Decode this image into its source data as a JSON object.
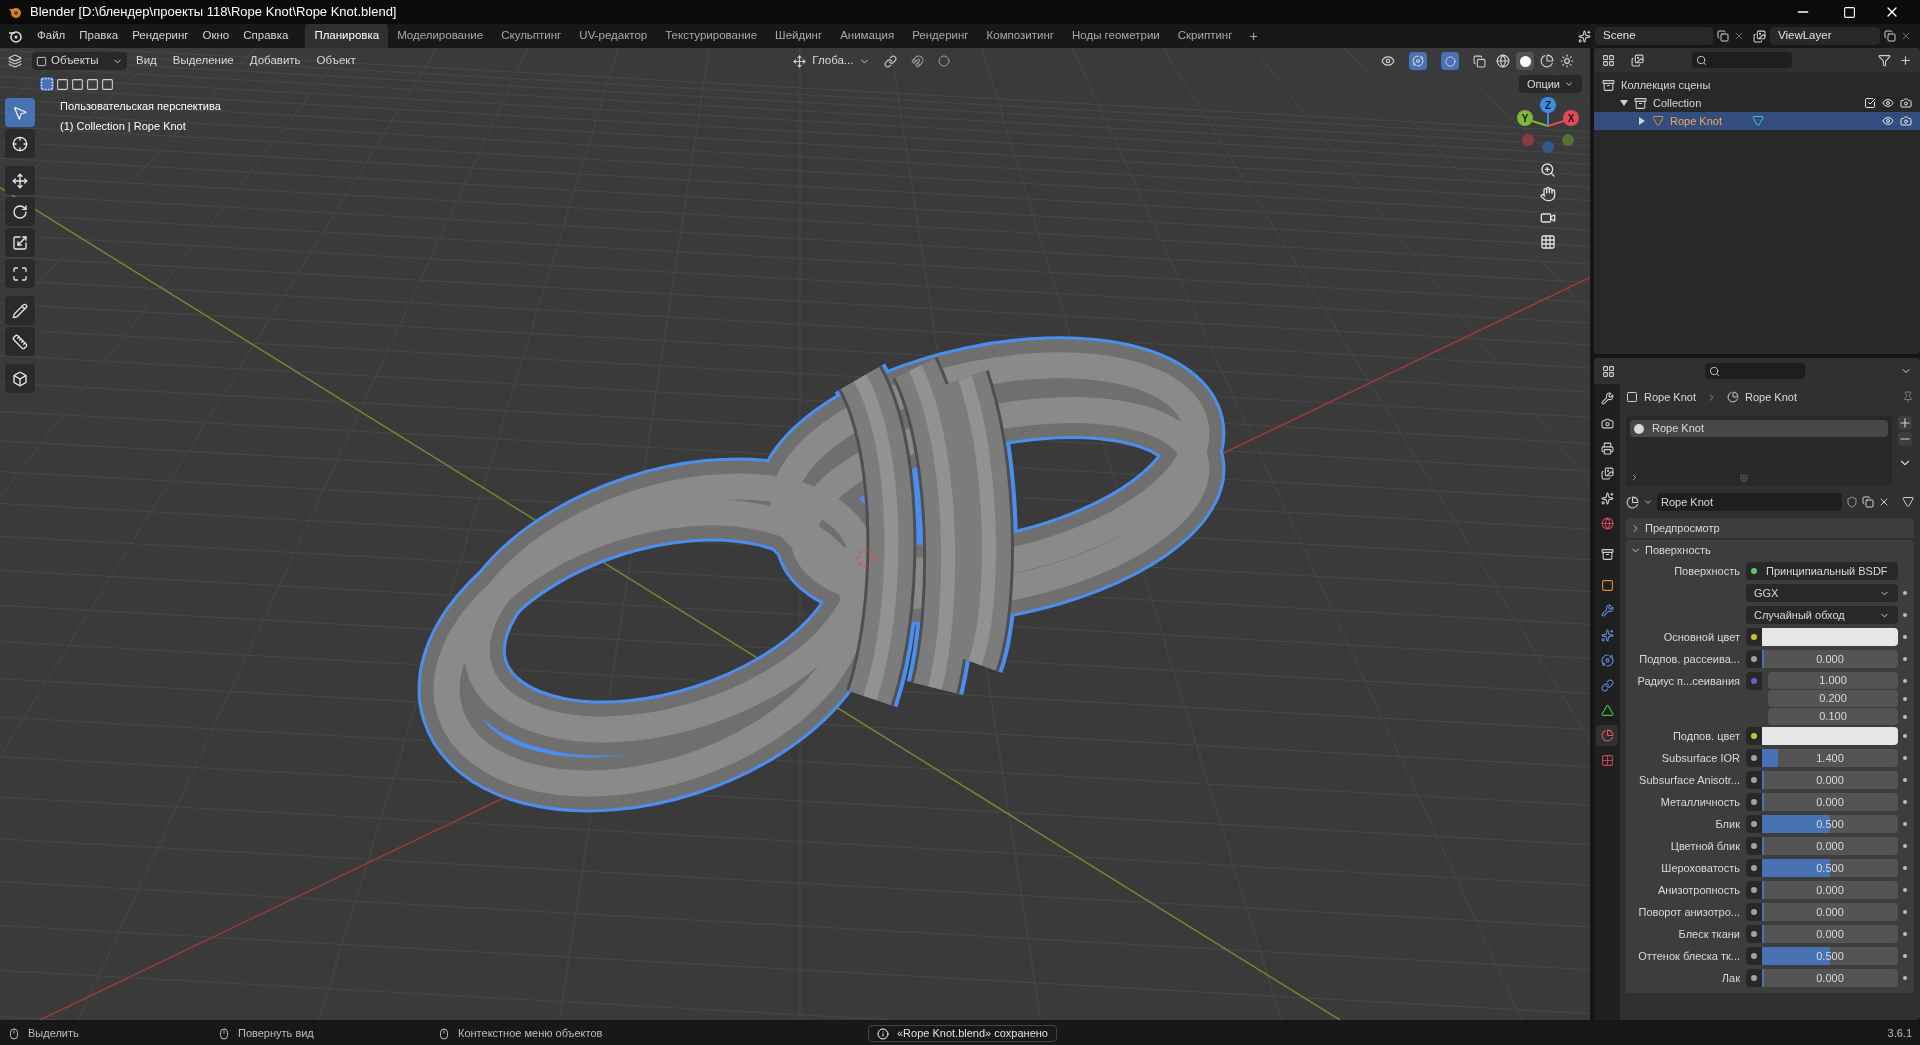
{
  "window": {
    "title": "Blender [D:\\блендер\\проекты 118\\Rope Knot\\Rope Knot.blend]"
  },
  "menu": [
    "Файл",
    "Правка",
    "Рендеринг",
    "Окно",
    "Справка"
  ],
  "workspaces": [
    {
      "label": "Планировка",
      "selected": true
    },
    {
      "label": "Моделирование",
      "selected": false
    },
    {
      "label": "Скульптинг",
      "selected": false
    },
    {
      "label": "UV-редактор",
      "selected": false
    },
    {
      "label": "Текстурирование",
      "selected": false
    },
    {
      "label": "Шейдинг",
      "selected": false
    },
    {
      "label": "Анимация",
      "selected": false
    },
    {
      "label": "Рендеринг",
      "selected": false
    },
    {
      "label": "Композитинг",
      "selected": false
    },
    {
      "label": "Ноды геометрии",
      "selected": false
    },
    {
      "label": "Скриптинг",
      "selected": false
    }
  ],
  "add_workspace": "+",
  "scene": "Scene",
  "view_layer": "ViewLayer",
  "viewport": {
    "mode": "Объекты",
    "menus": [
      "Вид",
      "Выделение",
      "Добавить",
      "Объект"
    ],
    "orientation": "Глоба...",
    "options": "Опции",
    "overlay_text": [
      "Пользовательская перспектива",
      "(1) Collection | Rope Knot"
    ],
    "gizmo": [
      "Z",
      "Y",
      "X"
    ],
    "tools": [
      {
        "kind": "select",
        "selected": true
      },
      {
        "kind": "cursor",
        "selected": false
      },
      {
        "kind": "move",
        "selected": false
      },
      {
        "kind": "rotate",
        "selected": false
      },
      {
        "kind": "scale",
        "selected": false
      },
      {
        "kind": "transform",
        "selected": false
      },
      {
        "kind": "annotate",
        "selected": false
      },
      {
        "kind": "measure",
        "selected": false
      },
      {
        "kind": "add_cube",
        "selected": false
      }
    ]
  },
  "outliner": {
    "items": [
      {
        "label": "Коллекция сцены",
        "kind": "scene_collection",
        "children": [
          {
            "label": "Collection",
            "kind": "collection",
            "expanded": true,
            "checked": true,
            "children": [
              {
                "label": "Rope Knot",
                "kind": "object",
                "expanded": false,
                "selected": true
              }
            ]
          }
        ]
      }
    ]
  },
  "properties": {
    "tabs": [
      {
        "kind": "tool",
        "selected": false
      },
      {
        "kind": "render",
        "selected": false
      },
      {
        "kind": "output",
        "selected": false
      },
      {
        "kind": "view_layer",
        "selected": false
      },
      {
        "kind": "scene",
        "selected": false
      },
      {
        "kind": "world",
        "selected": false
      },
      {
        "kind": "collection",
        "selected": false
      },
      {
        "kind": "object",
        "selected": false
      },
      {
        "kind": "modifiers",
        "selected": false
      },
      {
        "kind": "particles",
        "selected": false
      },
      {
        "kind": "physics",
        "selected": false
      },
      {
        "kind": "constraints",
        "selected": false
      },
      {
        "kind": "data",
        "selected": false
      },
      {
        "kind": "material",
        "selected": true
      },
      {
        "kind": "texture",
        "selected": false
      }
    ],
    "breadcrumb": [
      "Rope Knot",
      "Rope Knot"
    ],
    "slots": [
      {
        "label": "Rope Knot",
        "selected": true
      }
    ],
    "material": "Rope Knot",
    "panels": [
      {
        "label": "Предпросмотр",
        "expanded": false
      },
      {
        "label": "Поверхность",
        "expanded": true
      }
    ],
    "fields": [
      {
        "kind": "shader",
        "label": "Поверхность",
        "value": "Принципиальный BSDF",
        "socket": {
          "color": "#63c763"
        }
      },
      {
        "kind": "dropdown",
        "value": "GGX"
      },
      {
        "kind": "dropdown",
        "value": "Случайный обход"
      },
      {
        "kind": "color",
        "label": "Основной цвет",
        "socket": {
          "color": "#c7c729"
        },
        "color": "#e6e6e6"
      },
      {
        "kind": "slider",
        "label": "Подпов. рассеива...",
        "value": "0.000",
        "level": 0,
        "socket": {
          "color": "#a1a1a1"
        }
      },
      {
        "kind": "vector",
        "label": "Радиус п...сеивания",
        "values": [
          "1.000",
          "0.200",
          "0.100"
        ],
        "socket": {
          "color": "#6363c7"
        }
      },
      {
        "kind": "color",
        "label": "Подпов. цвет",
        "socket": {
          "color": "#c7c729"
        },
        "color": "#e6e6e6"
      },
      {
        "kind": "slider",
        "label": "Subsurface IOR",
        "value": "1.400",
        "level": 0.12,
        "socket": {
          "color": "#a1a1a1"
        }
      },
      {
        "kind": "slider",
        "label": "Subsurface Anisotr...",
        "value": "0.000",
        "level": 0,
        "socket": {
          "color": "#a1a1a1"
        }
      },
      {
        "kind": "slider",
        "label": "Металличность",
        "value": "0.000",
        "level": 0,
        "socket": {
          "color": "#a1a1a1"
        }
      },
      {
        "kind": "slider",
        "label": "Блик",
        "value": "0.500",
        "level": 0.5,
        "socket": {
          "color": "#a1a1a1"
        }
      },
      {
        "kind": "slider",
        "label": "Цветной блик",
        "value": "0.000",
        "level": 0,
        "socket": {
          "color": "#a1a1a1"
        }
      },
      {
        "kind": "slider",
        "label": "Шероховатость",
        "value": "0.500",
        "level": 0.5,
        "socket": {
          "color": "#a1a1a1"
        }
      },
      {
        "kind": "slider",
        "label": "Анизотропность",
        "value": "0.000",
        "level": 0,
        "socket": {
          "color": "#a1a1a1"
        }
      },
      {
        "kind": "slider",
        "label": "Поворот анизотро...",
        "value": "0.000",
        "level": 0,
        "socket": {
          "color": "#a1a1a1"
        }
      },
      {
        "kind": "slider",
        "label": "Блеск ткани",
        "value": "0.000",
        "level": 0,
        "socket": {
          "color": "#a1a1a1"
        }
      },
      {
        "kind": "slider",
        "label": "Оттенок блеска тк...",
        "value": "0.500",
        "level": 0.5,
        "socket": {
          "color": "#a1a1a1"
        }
      },
      {
        "kind": "slider",
        "label": "Лак",
        "value": "0.000",
        "level": 0,
        "socket": {
          "color": "#a1a1a1"
        }
      }
    ]
  },
  "status_bar": {
    "hints": [
      "Выделить",
      "Повернуть вид",
      "Контекстное меню объектов"
    ],
    "notice": "«Rope Knot.blend» сохранено",
    "version": "3.6.1"
  }
}
